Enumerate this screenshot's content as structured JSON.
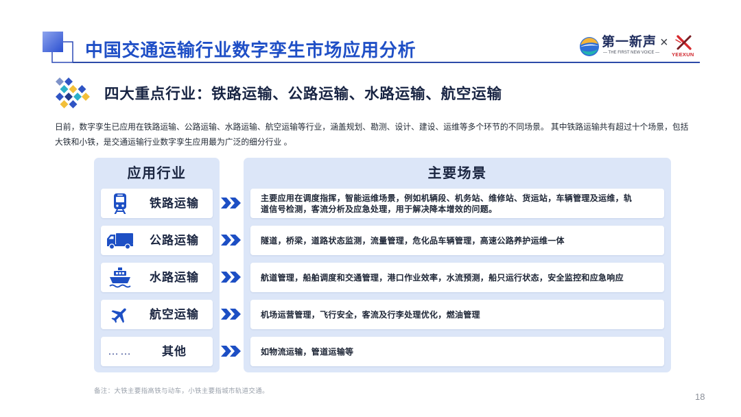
{
  "header": {
    "title": "中国交通运输行业数字孪生市场应用分析",
    "logo": {
      "brand": "第一新声",
      "tagline": "— THE FIRST NEW VOICE —",
      "separator": "×",
      "partner": "YEEXUN"
    }
  },
  "section": {
    "icon": "diamond-grid-icon",
    "heading": "四大重点行业：铁路运输、公路运输、水路运输、航空运输"
  },
  "intro": {
    "lines": [
      "日前，数字孪生已应用在铁路运输、公路运输、水路运输、航空运输等行业，涵盖规划、勘测、设计、建设、运维等多个环节的不同场景。 其中铁路运输共有超过十个场景，包括",
      "大铁和小铁，是交通运输行业数字孪生应用最为广泛的细分行业 。"
    ]
  },
  "table": {
    "industry_header": "应用行业",
    "scene_header": "主要场景",
    "rows": [
      {
        "icon": "train-icon",
        "label": "铁路运输",
        "scene": "主要应用在调度指挥，智能运维场景，例如机辆段、机务站、维修站、货运站，车辆管理及运维，轨道信号检测，客流分析及应急处理，用于解决降本增效的问题。"
      },
      {
        "icon": "truck-icon",
        "label": "公路运输",
        "scene": "隧道，桥梁，道路状态监测，流量管理，危化品车辆管理，高速公路养护运维一体"
      },
      {
        "icon": "ship-icon",
        "label": "水路运输",
        "scene": "航道管理，船舶调度和交通管理，港口作业效率，水流预测，船只运行状态，安全监控和应急响应"
      },
      {
        "icon": "airplane-icon",
        "label": "航空运输",
        "scene": "机场运营管理，飞行安全，客流及行李处理优化，燃油管理"
      },
      {
        "icon": "ellipsis-icon",
        "icon_text": "……",
        "label": "其他",
        "scene": "如物流运输，管道运输等"
      }
    ]
  },
  "footnote": "备注：大铁主要指高铁与动车，小铁主要指城市轨道交通。",
  "page_number": "18",
  "colors": {
    "title_blue": "#1f4fc6",
    "icon_blue": "#1d4fc4",
    "panel_bg": "#dce6f8",
    "card_bg": "#ffffff",
    "heading_navy": "#182443",
    "footnote_grey": "#9aa1ab",
    "brand_red": "#d0282e"
  }
}
